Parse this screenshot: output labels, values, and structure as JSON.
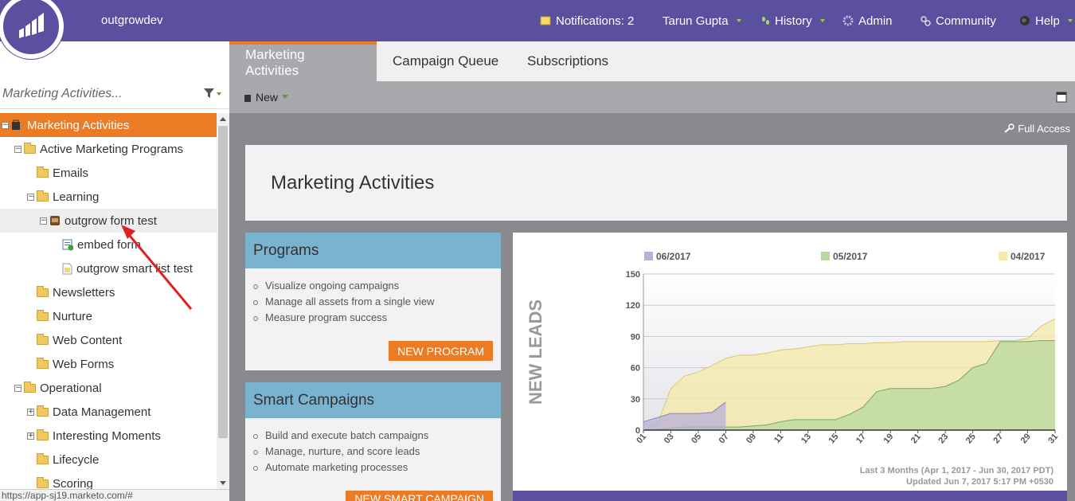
{
  "topbar": {
    "workspace": "outgrowdev",
    "notifications": "Notifications: 2",
    "user": "Tarun Gupta",
    "history": "History",
    "admin": "Admin",
    "community": "Community",
    "help": "Help"
  },
  "search": {
    "placeholder": "Marketing Activities..."
  },
  "tree": [
    {
      "label": "Marketing Activities"
    },
    {
      "label": "Active Marketing Programs"
    },
    {
      "label": "Emails"
    },
    {
      "label": "Learning"
    },
    {
      "label": "outgrow form test"
    },
    {
      "label": "embed form"
    },
    {
      "label": "outgrow smart list test"
    },
    {
      "label": "Newsletters"
    },
    {
      "label": "Nurture"
    },
    {
      "label": "Web Content"
    },
    {
      "label": "Web Forms"
    },
    {
      "label": "Operational"
    },
    {
      "label": "Data Management"
    },
    {
      "label": "Interesting Moments"
    },
    {
      "label": "Lifecycle"
    },
    {
      "label": "Scoring"
    }
  ],
  "status_url": "https://app-sj19.marketo.com/#",
  "tabs": [
    "Marketing Activities",
    "Campaign Queue",
    "Subscriptions"
  ],
  "toolbar": {
    "new_label": "New"
  },
  "access": "Full Access",
  "page_title": "Marketing Activities",
  "programs": {
    "title": "Programs",
    "items": [
      "Visualize ongoing campaigns",
      "Manage all assets from a single view",
      "Measure program success"
    ],
    "button": "NEW PROGRAM"
  },
  "smart_campaigns": {
    "title": "Smart Campaigns",
    "items": [
      "Build and execute batch campaigns",
      "Manage, nurture, and score leads",
      "Automate marketing processes"
    ],
    "button": "NEW SMART CAMPAIGN"
  },
  "chart_data": {
    "type": "area",
    "ylabel": "NEW LEADS",
    "ylim": [
      0,
      150
    ],
    "y_ticks": [
      0,
      30,
      60,
      90,
      120,
      150
    ],
    "x_ticks": [
      "01",
      "03",
      "05",
      "07",
      "09",
      "11",
      "13",
      "15",
      "17",
      "19",
      "21",
      "23",
      "25",
      "27",
      "29",
      "31"
    ],
    "legend": [
      "06/2017",
      "05/2017",
      "04/2017"
    ],
    "series_colors": {
      "06/2017": "#b8b0d8",
      "05/2017": "#b8d8a0",
      "04/2017": "#f5eaa8"
    },
    "series": [
      {
        "name": "06/2017",
        "x": [
          1,
          2,
          3,
          4,
          5,
          6,
          7
        ],
        "values": [
          8,
          12,
          16,
          16,
          16,
          17,
          27
        ]
      },
      {
        "name": "05/2017",
        "x": [
          1,
          2,
          3,
          4,
          5,
          6,
          7,
          8,
          9,
          10,
          11,
          12,
          13,
          14,
          15,
          16,
          17,
          18,
          19,
          20,
          21,
          22,
          23,
          24,
          25,
          26,
          27,
          28,
          29,
          30,
          31
        ],
        "values": [
          0,
          1,
          2,
          3,
          3,
          3,
          3,
          3,
          4,
          5,
          8,
          10,
          10,
          10,
          10,
          15,
          22,
          37,
          40,
          40,
          40,
          40,
          42,
          48,
          60,
          64,
          85,
          85,
          85,
          86,
          86
        ]
      },
      {
        "name": "04/2017",
        "x": [
          1,
          2,
          3,
          4,
          5,
          6,
          7,
          8,
          9,
          10,
          11,
          12,
          13,
          14,
          15,
          16,
          17,
          18,
          19,
          20,
          21,
          22,
          23,
          24,
          25,
          26,
          27,
          28,
          29,
          30,
          31
        ],
        "values": [
          0,
          5,
          40,
          52,
          56,
          62,
          69,
          72,
          72,
          74,
          77,
          78,
          80,
          82,
          82,
          83,
          83,
          84,
          84,
          85,
          85,
          85,
          85,
          85,
          85,
          85,
          86,
          86,
          88,
          100,
          107
        ]
      }
    ],
    "footnote1": "Last 3 Months (Apr 1, 2017 - Jun 30, 2017 PDT)",
    "footnote2": "Updated Jun 7, 2017 5:17 PM +0530"
  },
  "colors": {
    "brand": "#5b4fa0",
    "accent": "#eb7b24",
    "card_header": "#7ab3d0"
  }
}
